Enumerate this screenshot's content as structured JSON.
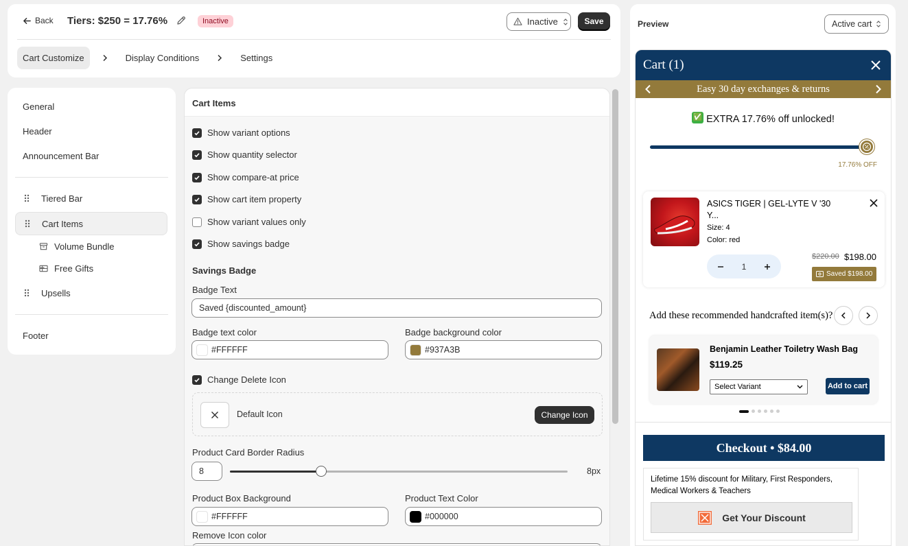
{
  "header": {
    "back_label": "Back",
    "title": "Tiers: $250 = 17.76%",
    "status_badge": "Inactive",
    "status_select": "Inactive",
    "save_label": "Save"
  },
  "tabs": [
    {
      "label": "Cart Customize",
      "active": true
    },
    {
      "label": "Display Conditions",
      "active": false
    },
    {
      "label": "Settings",
      "active": false
    }
  ],
  "sidebar": {
    "items": [
      {
        "label": "General"
      },
      {
        "label": "Header"
      },
      {
        "label": "Announcement Bar"
      },
      {
        "label": "Tiered Bar"
      },
      {
        "label": "Cart Items",
        "active": true
      },
      {
        "label": "Volume Bundle"
      },
      {
        "label": "Free Gifts"
      },
      {
        "label": "Upsells"
      },
      {
        "label": "Footer"
      }
    ]
  },
  "cart_items": {
    "title": "Cart Items",
    "checkboxes": [
      {
        "label": "Show variant options",
        "checked": true
      },
      {
        "label": "Show quantity selector",
        "checked": true
      },
      {
        "label": "Show compare-at price",
        "checked": true
      },
      {
        "label": "Show cart item property",
        "checked": true
      },
      {
        "label": "Show variant values only",
        "checked": false
      },
      {
        "label": "Show savings badge",
        "checked": true
      }
    ],
    "savings_badge_heading": "Savings Badge",
    "badge_text_label": "Badge Text",
    "badge_text_value": "Saved {discounted_amount}",
    "badge_text_color_label": "Badge text color",
    "badge_text_color": "#FFFFFF",
    "badge_bg_color_label": "Badge background color",
    "badge_bg_color": "#937A3B",
    "change_delete_icon_label": "Change Delete Icon",
    "change_delete_icon_checked": true,
    "default_icon_label": "Default Icon",
    "change_icon_label": "Change Icon",
    "border_radius_label": "Product Card Border Radius",
    "border_radius_value": "8",
    "border_radius_unit": "8px",
    "border_radius_fraction": 0.27,
    "product_box_bg_label": "Product Box Background",
    "product_box_bg": "#FFFFFF",
    "product_text_color_label": "Product Text Color",
    "product_text_color": "#000000",
    "remove_icon_color_label": "Remove Icon color"
  },
  "preview": {
    "title": "Preview",
    "cart_select": "Active cart",
    "cart_title": "Cart (1)",
    "announcement": "Easy 30 day exchanges & returns",
    "unlocked_emoji": "✅",
    "unlocked_text": "EXTRA 17.76% off unlocked!",
    "tier_off": "17.76% OFF",
    "item": {
      "name": "ASICS TIGER | GEL-LYTE V '30 Y...",
      "size": "Size: 4",
      "color": "Color: red",
      "qty": "1",
      "compare_price": "$220.00",
      "price": "$198.00",
      "saved": "Saved $198.00"
    },
    "recommend_title": "Add these recommended handcrafted item(s)?",
    "rec_item": {
      "name": "Benjamin Leather Toiletry Wash Bag",
      "price": "$119.25",
      "variant": "Select Variant",
      "add": "Add to cart"
    },
    "checkout": "Checkout • $84.00",
    "discount_text": "Lifetime 15% discount for Military, First Responders, Medical Workers & Teachers",
    "discount_btn": "Get Your Discount"
  },
  "colors": {
    "navy": "#0e3862",
    "gold": "#937a3b",
    "dark": "#303030"
  }
}
